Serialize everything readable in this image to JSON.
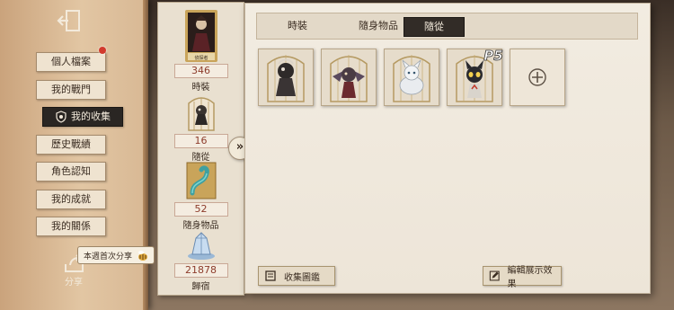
{
  "menu": {
    "items": [
      {
        "label": "個人檔案",
        "notify": true
      },
      {
        "label": "我的戰門"
      },
      {
        "label": "我的收集",
        "active": true
      },
      {
        "label": "歷史戰績"
      },
      {
        "label": "角色認知"
      },
      {
        "label": "我的成就"
      },
      {
        "label": "我的關係"
      }
    ],
    "share_label": "分享",
    "share_tip": "本週首次分享"
  },
  "stats": {
    "costume": {
      "value": "346",
      "label": "時裝",
      "badge": "偵探者"
    },
    "pets": {
      "value": "16",
      "label": "隨從"
    },
    "accessories": {
      "value": "52",
      "label": "隨身物品"
    },
    "homes": {
      "value": "21878",
      "label": "歸宿"
    }
  },
  "tabs": [
    {
      "label": "時裝"
    },
    {
      "label": "隨身物品"
    },
    {
      "label": "隨從",
      "active": true
    }
  ],
  "cards": [
    "bird-companion",
    "winged-creature-companion",
    "white-beast-companion",
    "morgana-cat-companion"
  ],
  "card_badge": "P5",
  "buttons": {
    "collection_guide": "收集圖鑑",
    "edit_display": "編輯展示效果"
  },
  "colors": {
    "active_tab": "#322c27",
    "stat_number": "#8d3c2b",
    "paper": "#f2ece1",
    "notify_dot": "#d23a2d"
  }
}
